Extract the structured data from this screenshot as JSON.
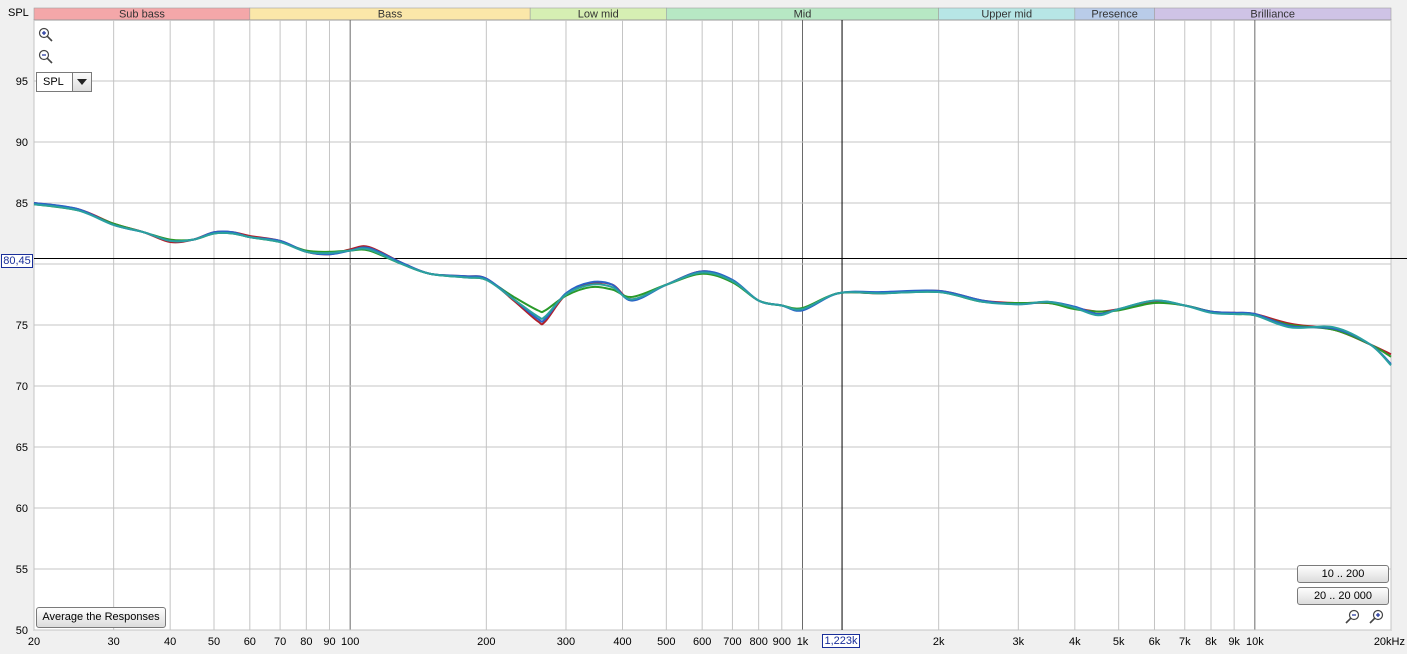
{
  "axis": {
    "y_title": "SPL",
    "x_unit_suffix": "Hz"
  },
  "cursor": {
    "y_value_label": "80,45",
    "y_value": 80.45,
    "x_value_label": "1,223k",
    "x_value": 1223
  },
  "controls": {
    "spl_select_value": "SPL",
    "average_button_label": "Average the Responses",
    "range_button_1_label": "10 .. 200",
    "range_button_2_label": "20 .. 20 000",
    "zoom_in_icon": "zoom-in-icon",
    "zoom_out_icon": "zoom-out-icon"
  },
  "bands": [
    {
      "label": "Sub bass",
      "from": 20,
      "to": 60,
      "color": "#f4a7a9"
    },
    {
      "label": "Bass",
      "from": 60,
      "to": 250,
      "color": "#fbe7a9"
    },
    {
      "label": "Low mid",
      "from": 250,
      "to": 500,
      "color": "#d6efb3"
    },
    {
      "label": "Mid",
      "from": 500,
      "to": 2000,
      "color": "#b7e8c4"
    },
    {
      "label": "Upper mid",
      "from": 2000,
      "to": 4000,
      "color": "#b7e6e6"
    },
    {
      "label": "Presence",
      "from": 4000,
      "to": 6000,
      "color": "#b9cce9"
    },
    {
      "label": "Brilliance",
      "from": 6000,
      "to": 20000,
      "color": "#cfc3e6"
    }
  ],
  "chart_data": {
    "type": "line",
    "xlabel": "",
    "ylabel": "SPL",
    "x_scale": "log",
    "xlim": [
      20,
      20000
    ],
    "ylim": [
      50,
      100
    ],
    "grid": true,
    "y_ticks": [
      50,
      55,
      60,
      65,
      70,
      75,
      80,
      85,
      90,
      95
    ],
    "x_ticks": [
      {
        "value": 20,
        "label": "20"
      },
      {
        "value": 30,
        "label": "30"
      },
      {
        "value": 40,
        "label": "40"
      },
      {
        "value": 50,
        "label": "50"
      },
      {
        "value": 60,
        "label": "60"
      },
      {
        "value": 70,
        "label": "70"
      },
      {
        "value": 80,
        "label": "80"
      },
      {
        "value": 90,
        "label": "90"
      },
      {
        "value": 100,
        "label": "100"
      },
      {
        "value": 200,
        "label": "200"
      },
      {
        "value": 300,
        "label": "300"
      },
      {
        "value": 400,
        "label": "400"
      },
      {
        "value": 500,
        "label": "500"
      },
      {
        "value": 600,
        "label": "600"
      },
      {
        "value": 700,
        "label": "700"
      },
      {
        "value": 800,
        "label": "800"
      },
      {
        "value": 900,
        "label": "900"
      },
      {
        "value": 1000,
        "label": "1k"
      },
      {
        "value": 2000,
        "label": "2k"
      },
      {
        "value": 3000,
        "label": "3k"
      },
      {
        "value": 4000,
        "label": "4k"
      },
      {
        "value": 5000,
        "label": "5k"
      },
      {
        "value": 6000,
        "label": "6k"
      },
      {
        "value": 7000,
        "label": "7k"
      },
      {
        "value": 8000,
        "label": "8k"
      },
      {
        "value": 9000,
        "label": "9k"
      },
      {
        "value": 10000,
        "label": "10k"
      },
      {
        "value": 20000,
        "label": "20kHz"
      }
    ],
    "major_x_lines": [
      100,
      1000,
      10000
    ],
    "series": [
      {
        "color": "#b0202a",
        "x": [
          20,
          25,
          30,
          35,
          40,
          45,
          50,
          55,
          60,
          70,
          80,
          90,
          100,
          110,
          130,
          150,
          180,
          200,
          230,
          260,
          270,
          300,
          340,
          380,
          420,
          500,
          600,
          700,
          800,
          900,
          1000,
          1200,
          1500,
          2000,
          2500,
          3000,
          3500,
          4000,
          4500,
          5000,
          6000,
          7000,
          8000,
          9000,
          10000,
          12000,
          15000,
          18000,
          20000
        ],
        "y": [
          85.0,
          84.5,
          83.3,
          82.6,
          81.8,
          82.0,
          82.6,
          82.6,
          82.3,
          81.9,
          81.0,
          80.8,
          81.2,
          81.4,
          80.1,
          79.2,
          79.0,
          78.8,
          77.0,
          75.3,
          75.3,
          77.5,
          78.4,
          78.3,
          77.1,
          78.3,
          79.4,
          78.6,
          77.0,
          76.6,
          76.3,
          77.6,
          77.6,
          77.8,
          77.0,
          76.8,
          76.8,
          76.4,
          76.1,
          76.3,
          76.9,
          76.6,
          76.1,
          76.0,
          75.9,
          75.1,
          74.6,
          73.4,
          72.6
        ]
      },
      {
        "color": "#2a9a2a",
        "x": [
          20,
          25,
          30,
          35,
          40,
          45,
          50,
          55,
          60,
          70,
          80,
          90,
          100,
          110,
          130,
          150,
          180,
          200,
          230,
          260,
          270,
          300,
          340,
          380,
          420,
          500,
          600,
          700,
          800,
          900,
          1000,
          1200,
          1500,
          2000,
          2500,
          3000,
          3500,
          4000,
          4500,
          5000,
          6000,
          7000,
          8000,
          9000,
          10000,
          12000,
          15000,
          18000,
          20000
        ],
        "y": [
          84.9,
          84.4,
          83.3,
          82.6,
          82.0,
          82.0,
          82.5,
          82.5,
          82.2,
          81.8,
          81.1,
          81.0,
          81.1,
          81.1,
          80.0,
          79.2,
          78.9,
          78.7,
          77.3,
          76.2,
          76.2,
          77.4,
          78.1,
          77.9,
          77.3,
          78.3,
          79.2,
          78.5,
          77.0,
          76.6,
          76.4,
          77.6,
          77.6,
          77.7,
          76.9,
          76.8,
          76.8,
          76.3,
          76.1,
          76.2,
          76.8,
          76.6,
          76.1,
          75.9,
          75.8,
          75.0,
          74.6,
          73.4,
          72.4
        ]
      },
      {
        "color": "#2a62c8",
        "x": [
          20,
          25,
          30,
          35,
          40,
          45,
          50,
          55,
          60,
          70,
          80,
          90,
          100,
          110,
          130,
          150,
          180,
          200,
          230,
          260,
          270,
          300,
          340,
          380,
          420,
          500,
          600,
          700,
          800,
          900,
          1000,
          1200,
          1500,
          2000,
          2500,
          3000,
          3500,
          4000,
          4500,
          5000,
          6000,
          7000,
          8000,
          9000,
          10000,
          12000,
          15000,
          18000,
          20000
        ],
        "y": [
          85.0,
          84.5,
          83.2,
          82.6,
          81.9,
          82.0,
          82.6,
          82.6,
          82.2,
          81.9,
          81.0,
          80.8,
          81.1,
          81.3,
          80.1,
          79.2,
          79.0,
          78.8,
          77.1,
          75.5,
          75.5,
          77.6,
          78.5,
          78.3,
          77.0,
          78.3,
          79.4,
          78.7,
          77.0,
          76.6,
          76.2,
          77.6,
          77.7,
          77.8,
          77.0,
          76.7,
          76.9,
          76.5,
          75.9,
          76.3,
          77.0,
          76.6,
          76.1,
          76.0,
          75.9,
          74.9,
          74.7,
          73.4,
          71.8
        ]
      },
      {
        "color": "#2aa0a0",
        "x": [
          20,
          25,
          30,
          35,
          40,
          45,
          50,
          55,
          60,
          70,
          80,
          90,
          100,
          110,
          130,
          150,
          180,
          200,
          230,
          260,
          270,
          300,
          340,
          380,
          420,
          500,
          600,
          700,
          800,
          900,
          1000,
          1200,
          1500,
          2000,
          2500,
          3000,
          3500,
          4000,
          4500,
          5000,
          6000,
          7000,
          8000,
          9000,
          10000,
          12000,
          15000,
          18000,
          20000
        ],
        "y": [
          84.9,
          84.4,
          83.2,
          82.6,
          81.9,
          82.0,
          82.5,
          82.5,
          82.2,
          81.8,
          81.0,
          80.9,
          81.1,
          81.2,
          80.0,
          79.2,
          78.9,
          78.7,
          77.1,
          75.7,
          75.7,
          77.5,
          78.3,
          78.1,
          77.1,
          78.3,
          79.3,
          78.6,
          77.0,
          76.6,
          76.3,
          77.6,
          77.6,
          77.7,
          76.9,
          76.7,
          76.9,
          76.4,
          75.8,
          76.3,
          77.0,
          76.6,
          76.0,
          75.9,
          75.8,
          74.8,
          74.8,
          73.4,
          71.7
        ]
      }
    ]
  }
}
